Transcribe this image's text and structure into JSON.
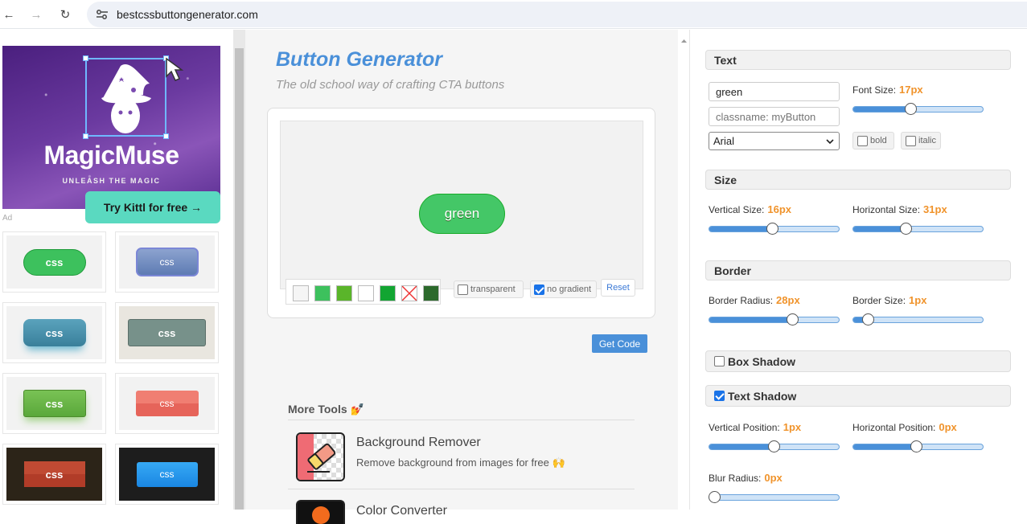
{
  "browser": {
    "url": "bestcssbuttongenerator.com"
  },
  "ad": {
    "brand": "MagicMuse",
    "tagline": "UNLEASH THE MAGIC",
    "cta": "Try Kittl for free →",
    "label": "Ad"
  },
  "presets": [
    "css",
    "css",
    "css",
    "css",
    "css",
    "css",
    "css",
    "css"
  ],
  "header": {
    "title": "Button Generator",
    "subtitle": "The old school way of crafting CTA buttons"
  },
  "preview": {
    "button_text": "green",
    "transparent_label": "transparent",
    "no_gradient_label": "no gradient",
    "reset_label": "Reset",
    "swatches": [
      "#f5f5f5",
      "#3dc15d",
      "#5ab52a",
      "#ffffff",
      "#12a532",
      "none",
      "#2c6a2c"
    ]
  },
  "get_code_label": "Get Code",
  "more_tools": {
    "heading": "More Tools 💅",
    "tools": [
      {
        "title": "Background Remover",
        "desc": "Remove background from images for free 🙌"
      },
      {
        "title": "Color Converter"
      }
    ]
  },
  "panel": {
    "text": {
      "heading": "Text",
      "value": "green",
      "classname_placeholder": "classname: myButton",
      "font": "Arial",
      "font_size_label": "Font Size:",
      "font_size": "17px",
      "font_size_level": 0.44,
      "bold_label": "bold",
      "italic_label": "italic"
    },
    "size": {
      "heading": "Size",
      "vertical_label": "Vertical Size:",
      "vertical": "16px",
      "vertical_level": 0.49,
      "horizontal_label": "Horizontal Size:",
      "horizontal": "31px",
      "horizontal_level": 0.4
    },
    "border": {
      "heading": "Border",
      "radius_label": "Border Radius:",
      "radius": "28px",
      "radius_level": 0.66,
      "size_label": "Border Size:",
      "size": "1px",
      "size_level": 0.08
    },
    "box_shadow": {
      "heading": "Box Shadow"
    },
    "text_shadow": {
      "heading": "Text Shadow",
      "vpos_label": "Vertical Position:",
      "vpos": "1px",
      "vpos_level": 0.5,
      "hpos_label": "Horizontal Position:",
      "hpos": "0px",
      "hpos_level": 0.49,
      "blur_label": "Blur Radius:",
      "blur": "0px",
      "blur_level": 0.0
    }
  }
}
